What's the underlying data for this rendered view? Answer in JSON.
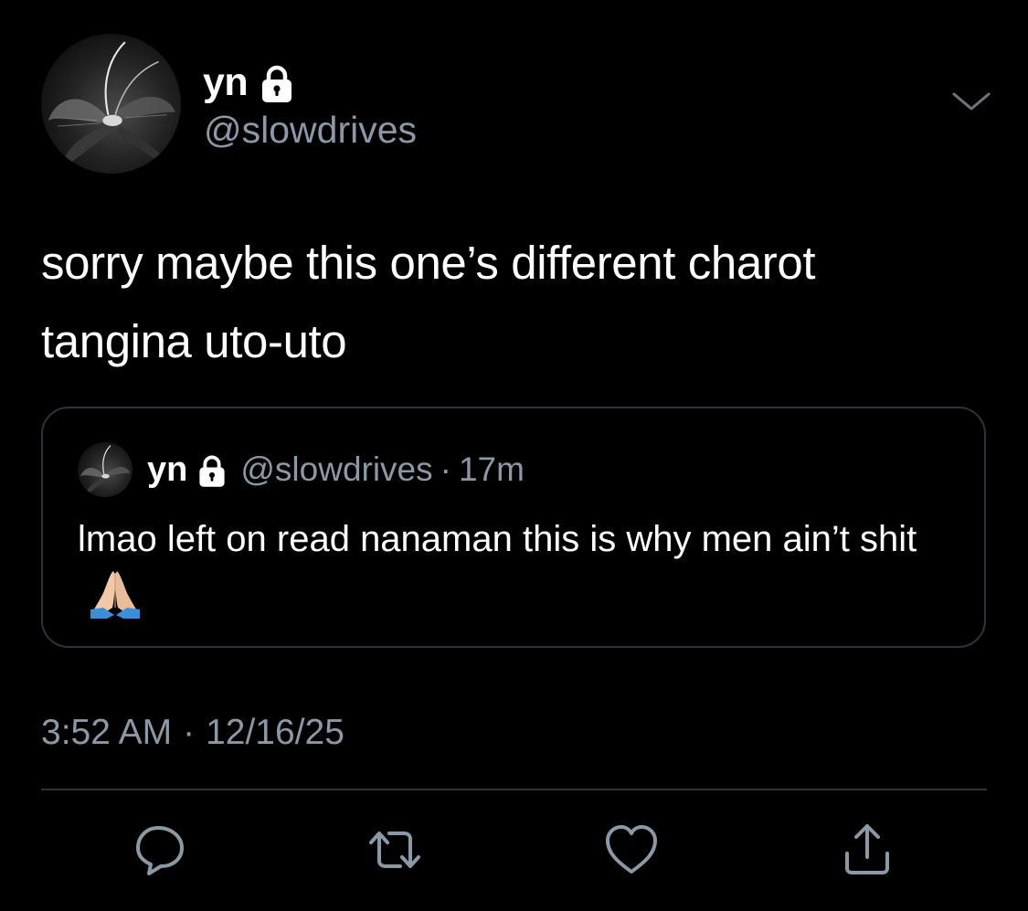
{
  "tweet": {
    "author": {
      "display_name": "yn",
      "handle": "@slowdrives",
      "protected_icon": "lock-icon",
      "avatar": "butterfly-photo-avatar"
    },
    "menu_icon": "chevron-down-icon",
    "text": "sorry maybe this one’s different charot\ntangina uto-uto",
    "quoted": {
      "display_name": "yn",
      "handle": "@slowdrives",
      "separator": "·",
      "time": "17m",
      "protected_icon": "lock-icon",
      "text": "lmao left on read nanaman this is why men ain’t shit",
      "emoji": "folded-hands-emoji"
    },
    "timestamp": {
      "time": "3:52 AM",
      "separator": "·",
      "date": "12/16/25"
    },
    "actions": [
      {
        "name": "reply",
        "icon": "reply-icon"
      },
      {
        "name": "retweet",
        "icon": "retweet-icon"
      },
      {
        "name": "like",
        "icon": "heart-icon"
      },
      {
        "name": "share",
        "icon": "share-icon"
      }
    ]
  },
  "colors": {
    "background": "#000000",
    "text": "#ffffff",
    "secondary_text": "#8b98a5",
    "border": "#2f3336"
  }
}
